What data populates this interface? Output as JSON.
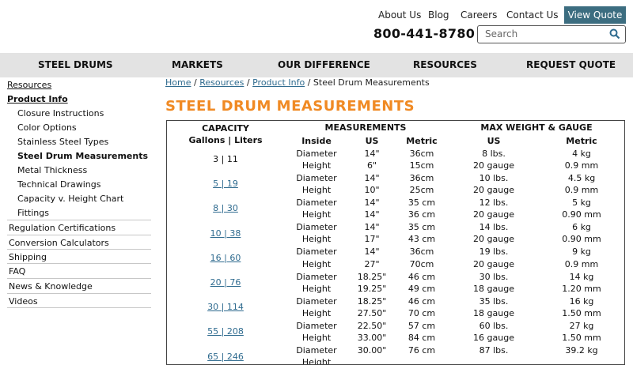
{
  "header": {
    "links": [
      "About Us",
      "Blog",
      "Careers",
      "Contact Us"
    ],
    "view_quote": "View Quote",
    "phone": "800-441-8780",
    "search_placeholder": "Search"
  },
  "nav": [
    "STEEL DRUMS",
    "MARKETS",
    "OUR DIFFERENCE",
    "RESOURCES",
    "REQUEST QUOTE"
  ],
  "sidebar": {
    "top": "Resources",
    "section": "Product Info",
    "sub": [
      "Closure Instructions",
      "Color Options",
      "Stainless Steel Types",
      "Steel Drum Measurements",
      "Metal Thickness",
      "Technical Drawings",
      "Capacity v. Height Chart",
      "Fittings"
    ],
    "active_sub_index": 3,
    "lower": [
      "Regulation Certifications",
      "Conversion Calculators",
      "Shipping",
      "FAQ",
      "News & Knowledge",
      "Videos"
    ]
  },
  "breadcrumb": {
    "items": [
      "Home",
      "Resources",
      "Product Info"
    ],
    "sep": "/",
    "current": "Steel Drum Measurements"
  },
  "page_title": "STEEL DRUM MEASUREMENTS",
  "table": {
    "headers": {
      "capacity": "CAPACITY",
      "capacity_sub": "Gallons | Liters",
      "measurements": "MEASUREMENTS",
      "max_weight": "MAX WEIGHT & GAUGE",
      "inside": "Inside",
      "us": "US",
      "metric": "Metric",
      "us2": "US",
      "metric2": "Metric"
    },
    "rows": [
      {
        "cap": "3 | 11",
        "link": false,
        "lines": [
          [
            "Diameter",
            "14\"",
            "36cm",
            "8 lbs.",
            "4 kg"
          ],
          [
            "Height",
            "6\"",
            "15cm",
            "20 gauge",
            "0.9 mm"
          ]
        ]
      },
      {
        "cap": "5 | 19",
        "link": true,
        "lines": [
          [
            "Diameter",
            "14\"",
            "36cm",
            "10 lbs.",
            "4.5 kg"
          ],
          [
            "Height",
            "10\"",
            "25cm",
            "20 gauge",
            "0.9 mm"
          ]
        ]
      },
      {
        "cap": "8 | 30",
        "link": true,
        "lines": [
          [
            "Diameter",
            "14\"",
            "35 cm",
            "12 lbs.",
            "5 kg"
          ],
          [
            "Height",
            "14\"",
            "36 cm",
            "20 gauge",
            "0.90 mm"
          ]
        ]
      },
      {
        "cap": "10 | 38",
        "link": true,
        "lines": [
          [
            "Diameter",
            "14\"",
            "35 cm",
            "14 lbs.",
            "6 kg"
          ],
          [
            "Height",
            "17\"",
            "43 cm",
            "20 gauge",
            "0.90 mm"
          ]
        ]
      },
      {
        "cap": "16 | 60",
        "link": true,
        "lines": [
          [
            "Diameter",
            "14\"",
            "36cm",
            "19 lbs.",
            "9 kg"
          ],
          [
            "Height",
            "27\"",
            "70cm",
            "20 gauge",
            "0.9 mm"
          ]
        ]
      },
      {
        "cap": "20 | 76",
        "link": true,
        "lines": [
          [
            "Diameter",
            "18.25\"",
            "46 cm",
            "30 lbs.",
            "14 kg"
          ],
          [
            "Height",
            "19.25\"",
            "49 cm",
            "18 gauge",
            "1.20 mm"
          ]
        ]
      },
      {
        "cap": "30 | 114",
        "link": true,
        "lines": [
          [
            "Diameter",
            "18.25\"",
            "46 cm",
            "35 lbs.",
            "16 kg"
          ],
          [
            "Height",
            "27.50\"",
            "70 cm",
            "18 gauge",
            "1.50 mm"
          ]
        ]
      },
      {
        "cap": "55 | 208",
        "link": true,
        "lines": [
          [
            "Diameter",
            "22.50\"",
            "57 cm",
            "60 lbs.",
            "27 kg"
          ],
          [
            "Height",
            "33.00\"",
            "84 cm",
            "16 gauge",
            "1.50 mm"
          ]
        ]
      },
      {
        "cap": "65 | 246",
        "link": true,
        "lines": [
          [
            "Diameter",
            "30.00\"",
            "76 cm",
            "87 lbs.",
            "39.2 kg"
          ],
          [
            "Height",
            "",
            "",
            "",
            ""
          ]
        ]
      }
    ]
  }
}
